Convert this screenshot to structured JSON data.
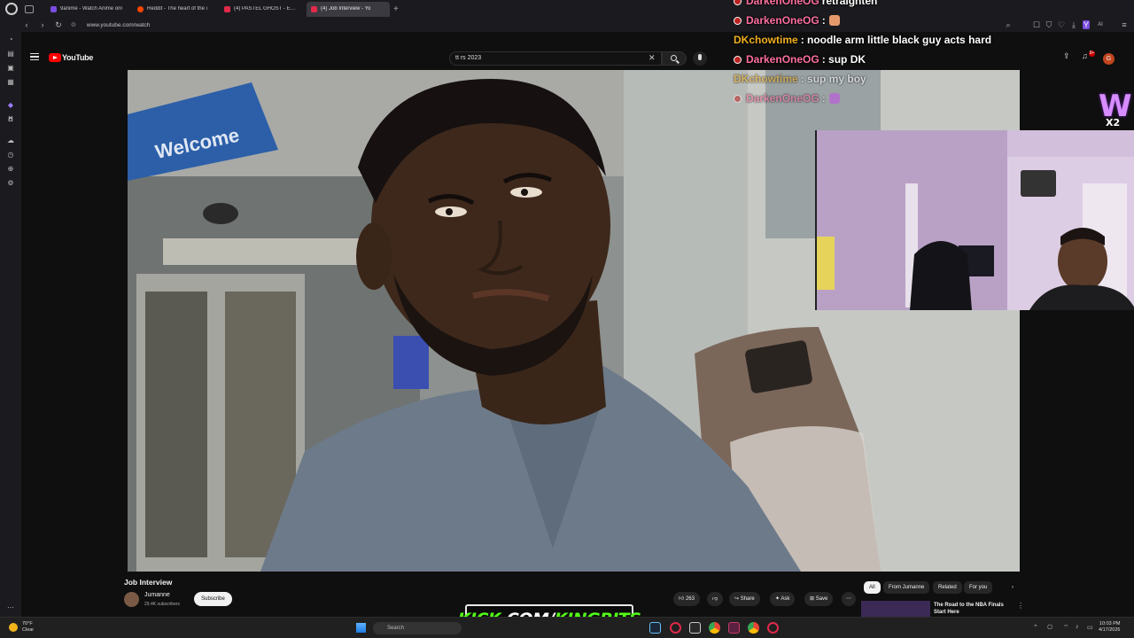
{
  "browser": {
    "tabs": [
      {
        "title": "9anime - Watch Anime onl",
        "color": "#7b4ce0"
      },
      {
        "title": "Reddit - The heart of the i",
        "color": "#ff4500"
      },
      {
        "title": "(4) PASTEL GHOST - EMPI",
        "color": "#e22a4b"
      },
      {
        "title": "(4) Job Interview - Yo",
        "color": "#e22a4b"
      }
    ],
    "url": "www.youtube.com/watch"
  },
  "youtube": {
    "logo_text": "YouTube",
    "search_value": "tt rs 2023",
    "notification_count": "9+",
    "avatar_letter": "G"
  },
  "video": {
    "sign_text": "Welcome"
  },
  "chat": [
    {
      "user": "DarkenOneOG",
      "message": "retraighten",
      "user_color": "pink",
      "badge": true,
      "faded": false
    },
    {
      "user": "DarkenOneOG",
      "message": ":",
      "user_color": "pink",
      "badge": true,
      "faded": false
    },
    {
      "user": "DKchowtime",
      "message": ": noodle arm little black guy acts hard",
      "user_color": "gold",
      "badge": false,
      "faded": false
    },
    {
      "user": "DarkenOneOG",
      "message": ": sup DK",
      "user_color": "pink",
      "badge": true,
      "faded": false
    },
    {
      "user": "DKchowtime",
      "message": ": sup my boy",
      "user_color": "gold",
      "badge": false,
      "faded": true
    },
    {
      "user": "DarkenOneOG",
      "message": ":",
      "user_color": "pink",
      "badge": true,
      "faded": true
    }
  ],
  "overlay": {
    "w_logo": "W",
    "multiplier": "X2",
    "kick_green": "KICK",
    "kick_white": ".COM/",
    "kick_green2": "KINGBITS"
  },
  "below_video": {
    "title": "Job Interview",
    "channel": "Jumanne",
    "subscribers": "29.4K subscribers",
    "subscribe_label": "Subscribe",
    "like_count": "263",
    "share_label": "Share",
    "ask_label": "Ask",
    "save_label": "Save",
    "chips": [
      "All",
      "From Jumanne",
      "Related",
      "For you"
    ],
    "rec_title": "The Road to the NBA Finals Start Here"
  },
  "taskbar": {
    "temp": "70°F",
    "condition": "Clear",
    "search_placeholder": "Search",
    "time": "10:03 PM",
    "date": "4/17/2026"
  },
  "colors": {
    "pink_user": "#ff6fa0",
    "gold_user": "#f2b020",
    "kick_green": "#53fc18"
  }
}
